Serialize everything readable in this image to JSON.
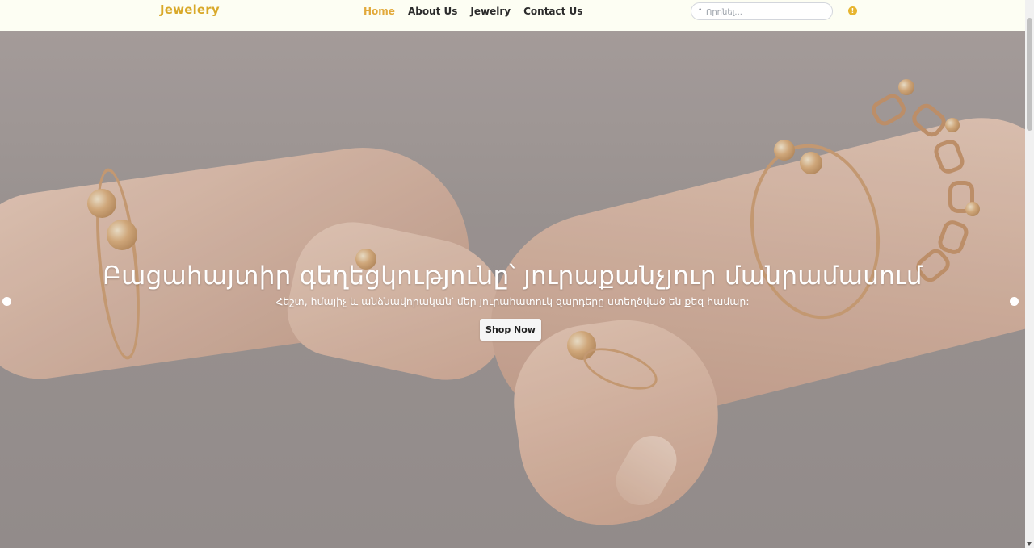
{
  "navbar": {
    "brand": "Jewelery",
    "links": [
      {
        "label": "Home",
        "active": true
      },
      {
        "label": "About Us",
        "active": false
      },
      {
        "label": "Jewelry",
        "active": false
      },
      {
        "label": "Contact Us",
        "active": false
      }
    ],
    "search": {
      "placeholder": "Որոնել...",
      "icon": "search-icon"
    },
    "cart": {
      "icon": "cart-badge-icon",
      "count": "!"
    },
    "accent_color": "#e2a93a"
  },
  "hero": {
    "title": "Բացահայտիր գեղեցկությունը՝ յուրաքանչյուր մանրամասում",
    "subtitle": "Հեշտ, հմայիչ և անձնավորական՝ մեր յուրահատուկ զարդերը ստեղծված են քեզ համար:",
    "cta_label": "Shop Now",
    "prev_icon": "carousel-dot-left-icon",
    "next_icon": "carousel-dot-right-icon"
  }
}
